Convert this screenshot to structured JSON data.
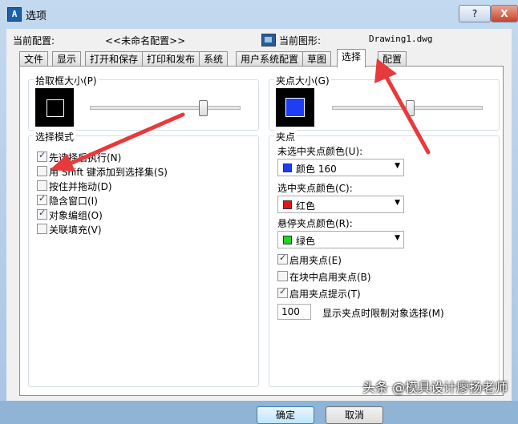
{
  "window": {
    "title": "选项",
    "help": "?",
    "close": "X",
    "app_icon": "app-icon",
    "app_icon_glyph": "A"
  },
  "header": {
    "profile_label": "当前配置:",
    "profile_value": "<<未命名配置>>",
    "drawing_label": "当前图形:",
    "drawing_value": "Drawing1.dwg"
  },
  "tabs": [
    "文件",
    "显示",
    "打开和保存",
    "打印和发布",
    "系统",
    "用户系统配置",
    "草图",
    "选择",
    "配置"
  ],
  "active_tab": "选择",
  "pickbox": {
    "label": "拾取框大小(P)",
    "level": 0.76
  },
  "selection_modes": {
    "label": "选择模式",
    "items": [
      {
        "label": "先选择后执行(N)",
        "checked": true
      },
      {
        "label": "用 Shift 键添加到选择集(S)",
        "checked": false
      },
      {
        "label": "按住并拖动(D)",
        "checked": false
      },
      {
        "label": "隐含窗口(I)",
        "checked": true
      },
      {
        "label": "对象编组(O)",
        "checked": true
      },
      {
        "label": "关联填充(V)",
        "checked": false
      }
    ]
  },
  "grip_size": {
    "label": "夹点大小(G)",
    "level": 0.52
  },
  "grips": {
    "label": "夹点",
    "unselected": {
      "label": "未选中夹点颜色(U):",
      "value": "颜色 160",
      "color": "#1e3df5"
    },
    "selected": {
      "label": "选中夹点颜色(C):",
      "value": "红色",
      "color": "#e31414"
    },
    "hover": {
      "label": "悬停夹点颜色(R):",
      "value": "绿色",
      "color": "#22d422"
    },
    "options": [
      {
        "label": "启用夹点(E)",
        "checked": true
      },
      {
        "label": "在块中启用夹点(B)",
        "checked": false
      },
      {
        "label": "启用夹点提示(T)",
        "checked": true
      }
    ],
    "limit_value": "100",
    "limit_label": "显示夹点时限制对象选择(M)"
  },
  "buttons": {
    "ok": "确定",
    "cancel": "取消"
  },
  "watermark": "头条 @模具设计廖扬老师",
  "colors": {
    "arrow": "#e8393c",
    "accent": "#3c7fb1"
  }
}
